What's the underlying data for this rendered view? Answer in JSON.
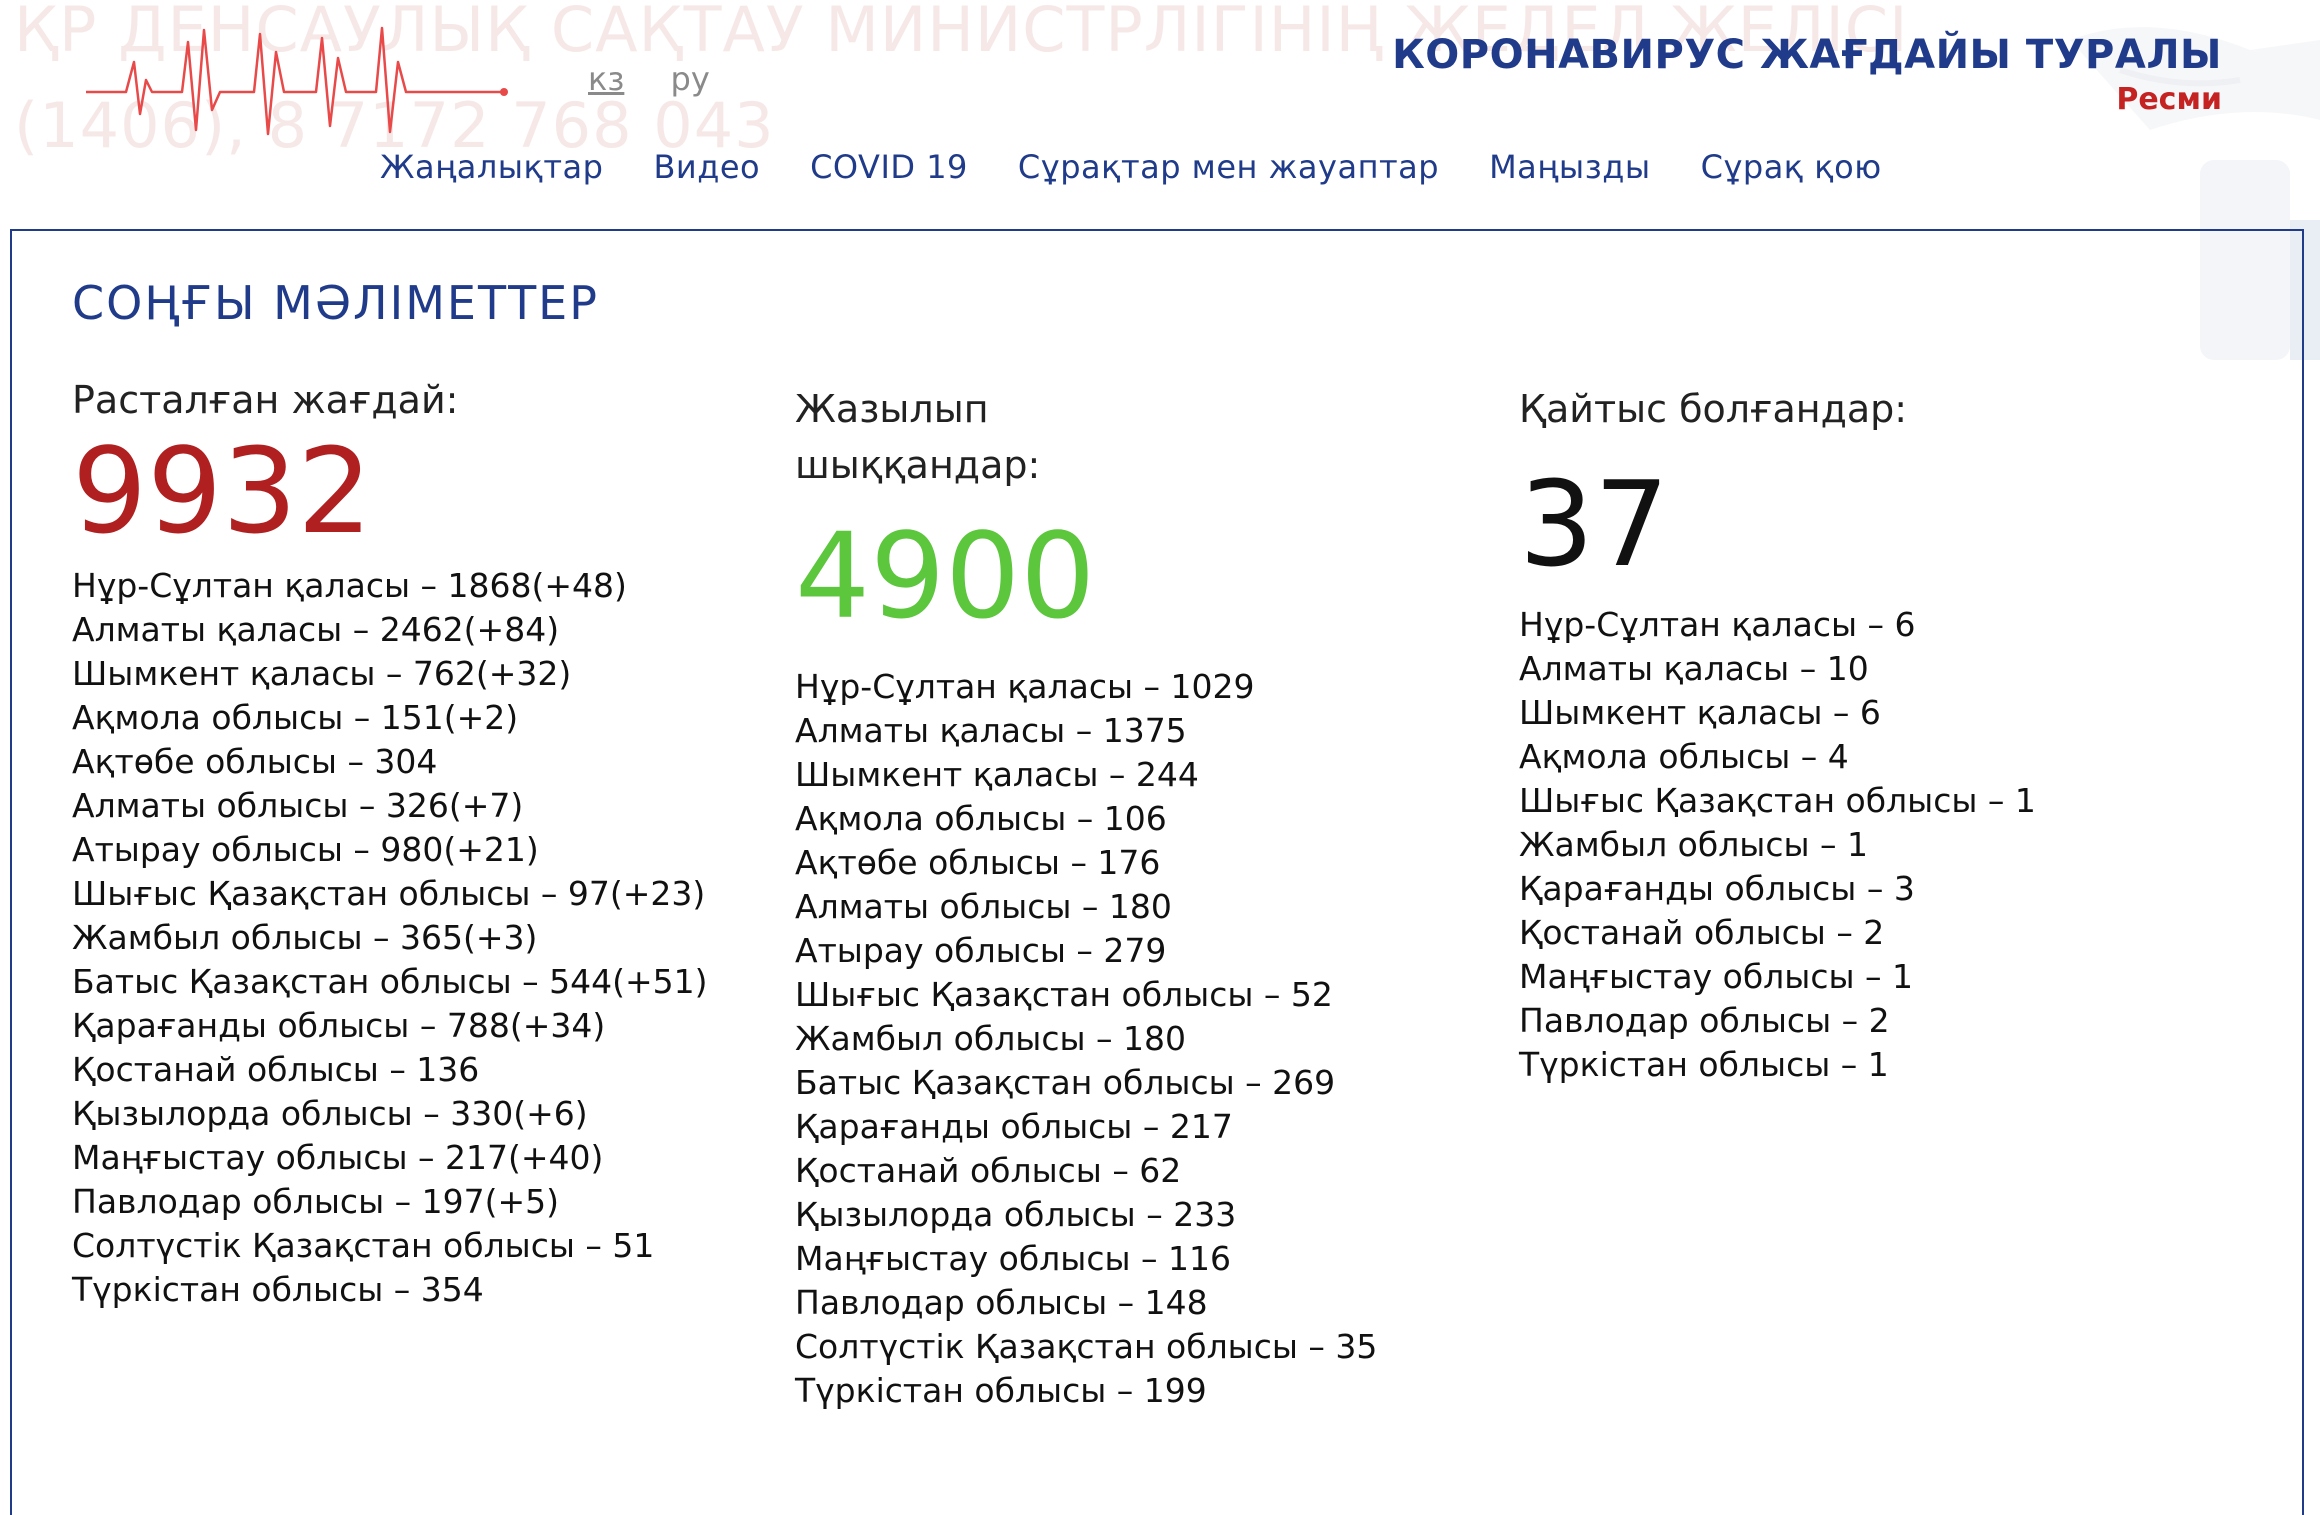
{
  "header": {
    "hotline_text_line1": "ҚР ДЕНСАУЛЫҚ САҚТАУ МИНИСТРЛІГІНІҢ ЖЕДЕЛ ЖЕЛІСІ",
    "hotline_text_line2": "(1406), 8 7172 768 043",
    "lang_kz": "кз",
    "lang_ru": "ру",
    "title": "КОРОНАВИРУС ЖАҒДАЙЫ ТУРАЛЫ",
    "subtitle": "Ресми"
  },
  "nav": {
    "items": [
      {
        "label": "Жаңалықтар"
      },
      {
        "label": "Видео"
      },
      {
        "label": "COVID 19"
      },
      {
        "label": "Сұрақтар мен жауаптар"
      },
      {
        "label": "Маңызды"
      },
      {
        "label": "Сұрақ қою"
      }
    ]
  },
  "stats": {
    "section_title": "СОҢҒЫ МӘЛІМЕТТЕР",
    "confirmed": {
      "label": "Расталған жағдай:",
      "total": "9932",
      "items": [
        "Нұр-Сұлтан қаласы – 1868(+48)",
        "Алматы қаласы – 2462(+84)",
        "Шымкент қаласы – 762(+32)",
        "Ақмола облысы – 151(+2)",
        "Ақтөбе облысы – 304",
        "Алматы облысы – 326(+7)",
        "Атырау облысы – 980(+21)",
        "Шығыс Қазақстан облысы – 97(+23)",
        "Жамбыл облысы – 365(+3)",
        "Батыс Қазақстан облысы – 544(+51)",
        "Қарағанды облысы – 788(+34)",
        "Қостанай облысы – 136",
        "Қызылорда облысы – 330(+6)",
        "Маңғыстау облысы – 217(+40)",
        "Павлодар облысы – 197(+5)",
        "Солтүстік Қазақстан облысы – 51",
        "Түркістан облысы – 354"
      ]
    },
    "recovered": {
      "label_line1": "Жазылып",
      "label_line2": "шыққандар:",
      "total": "4900",
      "items": [
        "Нұр-Сұлтан қаласы – 1029",
        "Алматы қаласы – 1375",
        "Шымкент қаласы – 244",
        "Ақмола облысы – 106",
        "Ақтөбе облысы – 176",
        "Алматы облысы – 180",
        "Атырау облысы – 279",
        "Шығыс Қазақстан облысы – 52",
        "Жамбыл облысы – 180",
        "Батыс Қазақстан облысы – 269",
        "Қарағанды облысы – 217",
        "Қостанай облысы – 62",
        "Қызылорда облысы – 233",
        "Маңғыстау облысы – 116",
        "Павлодар облысы – 148",
        "Солтүстік Қазақстан облысы – 35",
        "Түркістан облысы – 199"
      ]
    },
    "deaths": {
      "label": "Қайтыс болғандар:",
      "total": "37",
      "items": [
        "Нұр-Сұлтан қаласы – 6",
        "Алматы қаласы – 10",
        "Шымкент қаласы – 6",
        "Ақмола облысы – 4",
        "Шығыс Қазақстан облысы – 1",
        "Жамбыл облысы – 1",
        "Қарағанды облысы – 3",
        "Қостанай облысы – 2",
        "Маңғыстау облысы – 1",
        "Павлодар облысы – 2",
        "Түркістан облысы – 1"
      ]
    }
  },
  "colors": {
    "brand_blue": "#1f3b8a",
    "confirmed_red": "#b02020",
    "recovered_green": "#5cc63d",
    "deaths_black": "#111111",
    "subtitle_red": "#c52222",
    "ecg_red": "#e84a4a"
  },
  "icons": {
    "logo": "ecg-heartbeat-icon"
  }
}
